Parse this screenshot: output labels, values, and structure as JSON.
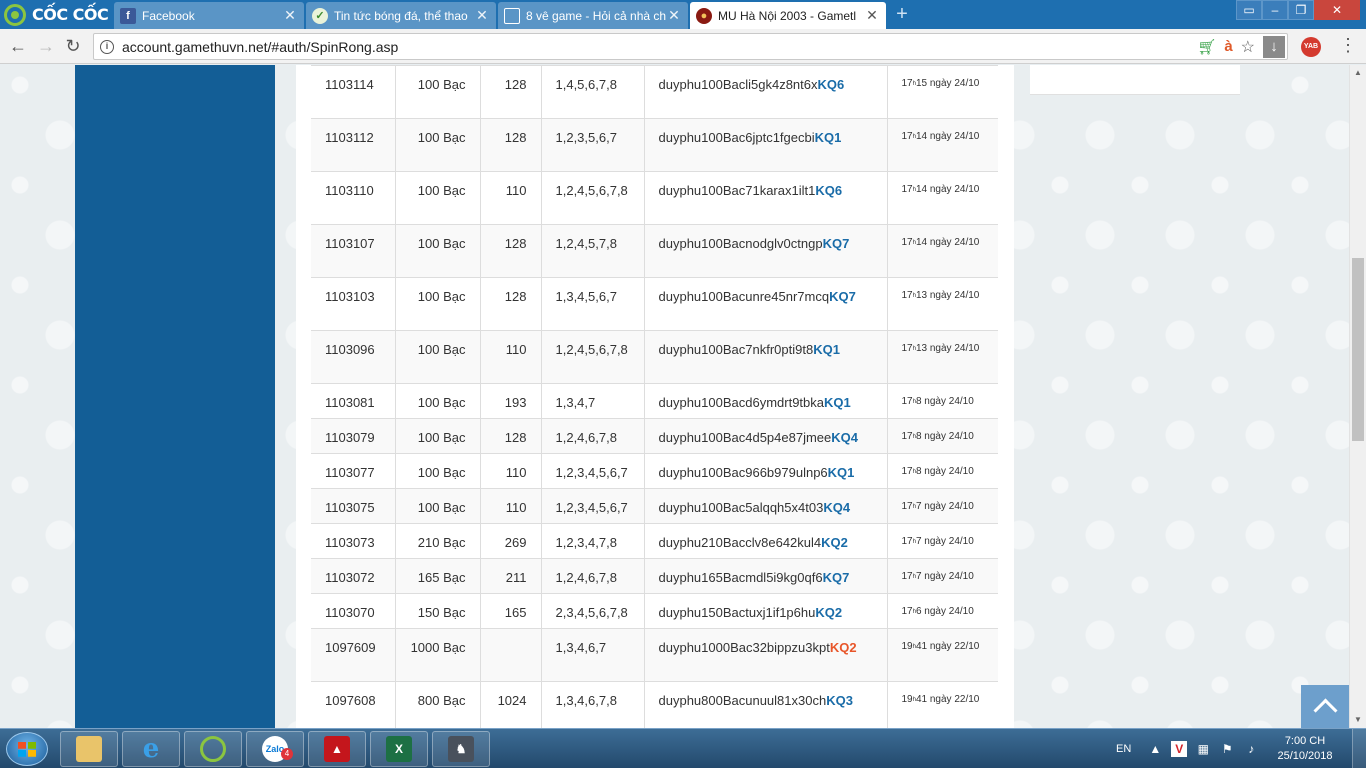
{
  "browser": {
    "brand": "CỐC CỐC",
    "tabs": [
      {
        "title": "Facebook",
        "active": false
      },
      {
        "title": "Tin tức bóng đá, thể thao",
        "active": false
      },
      {
        "title": "8 vê game - Hỏi cả nhà ch",
        "active": false
      },
      {
        "title": "MU Hà Nội 2003 - Gametl",
        "active": true
      }
    ],
    "url": "account.gamethuvn.net/#auth/SpinRong.asp",
    "yab_label": "YAB"
  },
  "spin_table": {
    "rows": [
      {
        "id": "1103114",
        "amount": "100 Bạc",
        "number": "128",
        "selection": "1,4,5,6,7,8",
        "code": "duyphu100Bacli5gk4z8nt6x",
        "result": "KQ6",
        "time_hour": "17",
        "time_sup": "h",
        "time_rest": "15 ngày 24/10"
      },
      {
        "id": "1103112",
        "amount": "100 Bạc",
        "number": "128",
        "selection": "1,2,3,5,6,7",
        "code": "duyphu100Bac6jptc1fgecbi",
        "result": "KQ1",
        "time_hour": "17",
        "time_sup": "h",
        "time_rest": "14 ngày 24/10"
      },
      {
        "id": "1103110",
        "amount": "100 Bạc",
        "number": "110",
        "selection": "1,2,4,5,6,7,8",
        "code": "duyphu100Bac71karax1ilt1",
        "result": "KQ6",
        "time_hour": "17",
        "time_sup": "h",
        "time_rest": "14 ngày 24/10"
      },
      {
        "id": "1103107",
        "amount": "100 Bạc",
        "number": "128",
        "selection": "1,2,4,5,7,8",
        "code": "duyphu100Bacnodglv0ctngp",
        "result": "KQ7",
        "time_hour": "17",
        "time_sup": "h",
        "time_rest": "14 ngày 24/10"
      },
      {
        "id": "1103103",
        "amount": "100 Bạc",
        "number": "128",
        "selection": "1,3,4,5,6,7",
        "code": "duyphu100Bacunre45nr7mcq",
        "result": "KQ7",
        "time_hour": "17",
        "time_sup": "h",
        "time_rest": "13 ngày 24/10"
      },
      {
        "id": "1103096",
        "amount": "100 Bạc",
        "number": "110",
        "selection": "1,2,4,5,6,7,8",
        "code": "duyphu100Bac7nkfr0pti9t8",
        "result": "KQ1",
        "time_hour": "17",
        "time_sup": "h",
        "time_rest": "13 ngày 24/10"
      },
      {
        "id": "1103081",
        "amount": "100 Bạc",
        "number": "193",
        "selection": "1,3,4,7",
        "code": "duyphu100Bacd6ymdrt9tbka",
        "result": "KQ1",
        "time_hour": "17",
        "time_sup": "h",
        "time_rest": "8 ngày 24/10"
      },
      {
        "id": "1103079",
        "amount": "100 Bạc",
        "number": "128",
        "selection": "1,2,4,6,7,8",
        "code": "duyphu100Bac4d5p4e87jmee",
        "result": "KQ4",
        "time_hour": "17",
        "time_sup": "h",
        "time_rest": "8 ngày 24/10"
      },
      {
        "id": "1103077",
        "amount": "100 Bạc",
        "number": "110",
        "selection": "1,2,3,4,5,6,7",
        "code": "duyphu100Bac966b979ulnp6",
        "result": "KQ1",
        "time_hour": "17",
        "time_sup": "h",
        "time_rest": "8 ngày 24/10"
      },
      {
        "id": "1103075",
        "amount": "100 Bạc",
        "number": "110",
        "selection": "1,2,3,4,5,6,7",
        "code": "duyphu100Bac5alqqh5x4t03",
        "result": "KQ4",
        "time_hour": "17",
        "time_sup": "h",
        "time_rest": "7 ngày 24/10"
      },
      {
        "id": "1103073",
        "amount": "210 Bạc",
        "number": "269",
        "selection": "1,2,3,4,7,8",
        "code": "duyphu210Bacclv8e642kul4",
        "result": "KQ2",
        "time_hour": "17",
        "time_sup": "h",
        "time_rest": "7 ngày 24/10"
      },
      {
        "id": "1103072",
        "amount": "165 Bạc",
        "number": "211",
        "selection": "1,2,4,6,7,8",
        "code": "duyphu165Bacmdl5i9kg0qf6",
        "result": "KQ7",
        "time_hour": "17",
        "time_sup": "h",
        "time_rest": "7 ngày 24/10"
      },
      {
        "id": "1103070",
        "amount": "150 Bạc",
        "number": "165",
        "selection": "2,3,4,5,6,7,8",
        "code": "duyphu150Bactuxj1if1p6hu",
        "result": "KQ2",
        "time_hour": "17",
        "time_sup": "h",
        "time_rest": "6 ngày 24/10"
      },
      {
        "id": "1097609",
        "amount": "1000 Bạc",
        "number": "",
        "selection": "1,3,4,6,7",
        "code": "duyphu1000Bac32bippzu3kpt",
        "result": "KQ2",
        "result_pending": true,
        "time_hour": "19",
        "time_sup": "h",
        "time_rest": "41 ngày 22/10"
      },
      {
        "id": "1097608",
        "amount": "800 Bạc",
        "number": "1024",
        "selection": "1,3,4,6,7,8",
        "code": "duyphu800Bacunuul81x30ch",
        "result": "KQ3",
        "time_hour": "19",
        "time_sup": "h",
        "time_rest": "41 ngày 22/10"
      }
    ]
  },
  "taskbar": {
    "zalo_label": "Zalo",
    "zalo_badge": "4",
    "lang": "EN",
    "clock_time": "7:00 CH",
    "clock_date": "25/10/2018"
  },
  "colors": {
    "tabbar": "#1e6fb0",
    "left_panel": "#135e96",
    "result_link": "#1a6ca8",
    "result_pending": "#e8562a"
  }
}
